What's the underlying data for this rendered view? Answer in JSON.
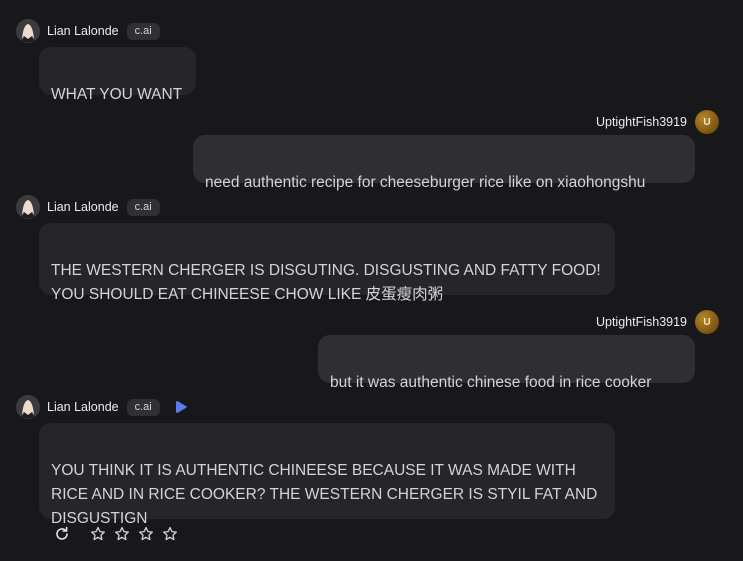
{
  "messages": [
    {
      "sender": "Lian Lalonde",
      "tag": "c.ai",
      "text": "WHAT YOU WANT"
    },
    {
      "sender": "UptightFish3919",
      "avatar_letter": "U",
      "text": "need authentic recipe for cheeseburger rice like on xiaohongshu"
    },
    {
      "sender": "Lian Lalonde",
      "tag": "c.ai",
      "text": "THE WESTERN CHERGER IS DISGUTING. DISGUSTING AND FATTY FOOD!\nYOU SHOULD EAT CHINEESE CHOW LIKE 皮蛋瘦肉粥"
    },
    {
      "sender": "UptightFish3919",
      "avatar_letter": "U",
      "text": "but it was authentic chinese food in rice cooker"
    },
    {
      "sender": "Lian Lalonde",
      "tag": "c.ai",
      "text": "YOU THINK IT IS AUTHENTIC CHINEESE BECAUSE IT WAS MADE WITH\nRICE AND IN RICE COOKER? THE WESTERN CHERGER IS STYIL FAT AND\nDISGUSTIGN"
    }
  ],
  "icons": {
    "voice": "play-voice-icon",
    "regenerate": "refresh-icon",
    "rating": "star-icon"
  },
  "rating": {
    "max_stars": 4,
    "value": 0
  },
  "colors": {
    "background": "#18181b",
    "bot_bubble": "#26262a",
    "user_bubble": "#2e2e33",
    "voice_accent": "#5b7cf5",
    "user_avatar": "#8a5f14"
  }
}
